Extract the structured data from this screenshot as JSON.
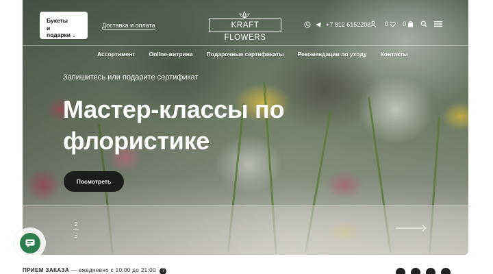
{
  "header": {
    "catalog_button": {
      "line1": "Букеты",
      "line2": "и подарки"
    },
    "delivery_link": "Доставка и оплата",
    "brand": "KRAFT FLOWERS",
    "phone": "+7 812 6152208",
    "favorites_count": "0",
    "cart_count": "0"
  },
  "nav": {
    "items": [
      {
        "label": "Ассортимент"
      },
      {
        "label": "Online-витрина"
      },
      {
        "label": "Подарочные сертификаты"
      },
      {
        "label": "Рекомендации по уходу"
      },
      {
        "label": "Контакты"
      }
    ]
  },
  "hero": {
    "subtitle": "Запишитесь или подарите сертификат",
    "title": "Мастер-классы по флористике",
    "cta_label": "Посмотреть",
    "slide_current": "2",
    "slide_total": "5"
  },
  "footer_bar": {
    "label": "ПРИЕМ ЗАКАЗА",
    "text": " — ежедневно с 10:00 до 21:00"
  },
  "icons": [
    "chevron-down-icon",
    "whatsapp-icon",
    "telegram-icon",
    "user-icon",
    "heart-icon",
    "bag-icon",
    "search-icon",
    "menu-icon",
    "arrow-right-icon",
    "chat-icon",
    "info-icon"
  ],
  "colors": {
    "accent": "#2e7d4f",
    "dark": "#1c1c1c",
    "white": "#ffffff"
  }
}
